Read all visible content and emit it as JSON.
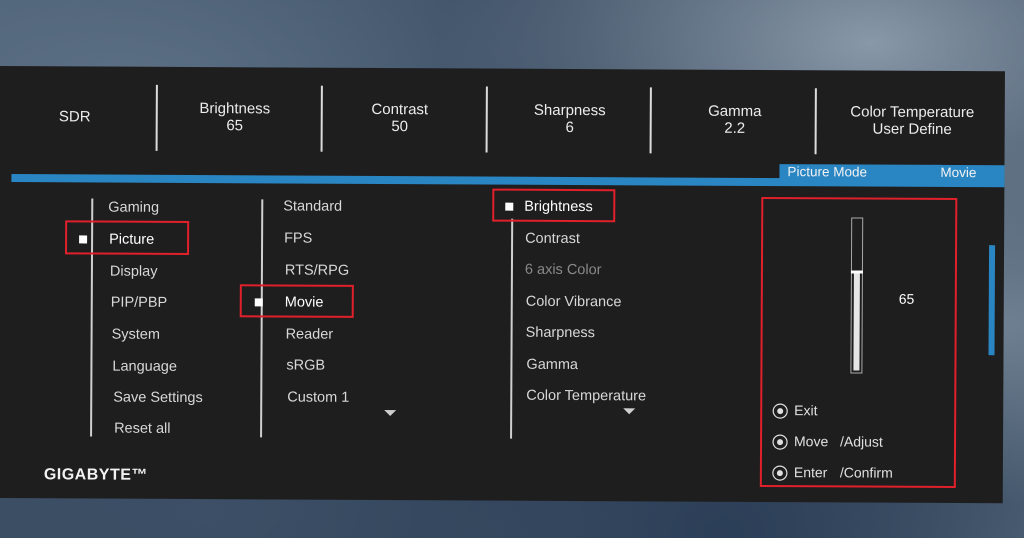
{
  "top": {
    "sdr": "SDR",
    "brightness_label": "Brightness",
    "brightness_value": "65",
    "contrast_label": "Contrast",
    "contrast_value": "50",
    "sharpness_label": "Sharpness",
    "sharpness_value": "6",
    "gamma_label": "Gamma",
    "gamma_value": "2.2",
    "colortemp_label": "Color Temperature",
    "colortemp_value": "User Define"
  },
  "tabs": {
    "picture_mode": "Picture Mode",
    "movie": "Movie"
  },
  "main_menu": [
    "Gaming",
    "Picture",
    "Display",
    "PIP/PBP",
    "System",
    "Language",
    "Save Settings",
    "Reset all"
  ],
  "mode_menu": [
    "Standard",
    "FPS",
    "RTS/RPG",
    "Movie",
    "Reader",
    "sRGB",
    "Custom 1"
  ],
  "settings_menu": [
    "Brightness",
    "Contrast",
    "6 axis Color",
    "Color Vibrance",
    "Sharpness",
    "Gamma",
    "Color Temperature"
  ],
  "slider": {
    "value": "65",
    "level": 0.65
  },
  "hints": {
    "exit": "Exit",
    "move": "Move",
    "adjust": "/Adjust",
    "enter": "Enter",
    "confirm": "/Confirm"
  },
  "brand": "GIGABYTE™",
  "colors": {
    "accent": "#2a86c3",
    "highlight": "#e0202a"
  }
}
